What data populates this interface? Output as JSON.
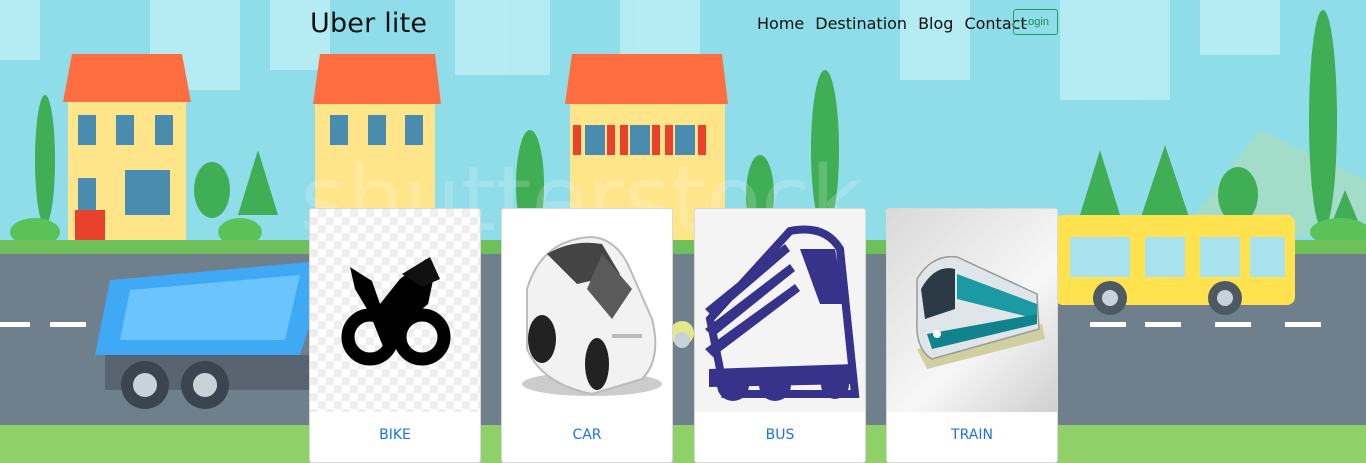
{
  "header": {
    "brand": "Uber lite",
    "nav": [
      "Home",
      "Destination",
      "Blog",
      "Contact"
    ],
    "login_label": "Login"
  },
  "cards": [
    {
      "label": "BIKE",
      "image": "motorcycle-icon"
    },
    {
      "label": "CAR",
      "image": "car-icon"
    },
    {
      "label": "BUS",
      "image": "bus-icon"
    },
    {
      "label": "TRAIN",
      "image": "train-icon"
    }
  ],
  "background": {
    "sky": "#8fdde9",
    "road": "#6f7f8b",
    "grass": "#8fd068",
    "house_roof": "#ff6e40",
    "house_wall": "#ffe58a",
    "bus_color": "#ffe24d"
  }
}
